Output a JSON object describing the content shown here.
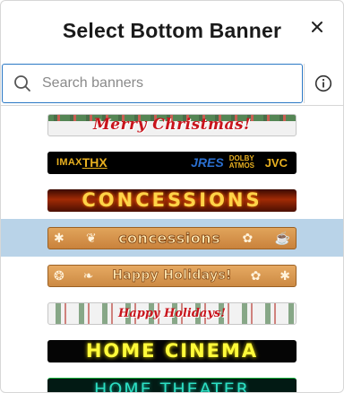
{
  "dialog": {
    "title": "Select Bottom Banner",
    "close_icon": "close-icon"
  },
  "search": {
    "placeholder": "Search banners",
    "value": "",
    "icon": "search-icon",
    "info_icon": "info-icon"
  },
  "banners": [
    {
      "name": "banner-merry-christmas",
      "text": "Merry Christmas!",
      "selected": false
    },
    {
      "name": "banner-brand-logos",
      "logos": [
        "IMAX",
        "THX",
        "JRES",
        "DOLBY ATMOS",
        "JVC"
      ],
      "selected": false
    },
    {
      "name": "banner-concessions-fire",
      "text": "CONCESSIONS",
      "selected": false
    },
    {
      "name": "banner-concessions-gingerbread",
      "text": "concessions",
      "selected": true
    },
    {
      "name": "banner-happy-holidays",
      "text": "Happy Holidays!",
      "selected": false
    },
    {
      "name": "banner-holly",
      "text": "Happy Holidays!",
      "selected": false
    },
    {
      "name": "banner-home-cinema",
      "text": "HOME CINEMA",
      "selected": false
    },
    {
      "name": "banner-home-theater",
      "text": "HOME THEATER",
      "selected": false
    }
  ],
  "colors": {
    "accent": "#2b78c5",
    "selected_row": "#b9d3e8"
  }
}
